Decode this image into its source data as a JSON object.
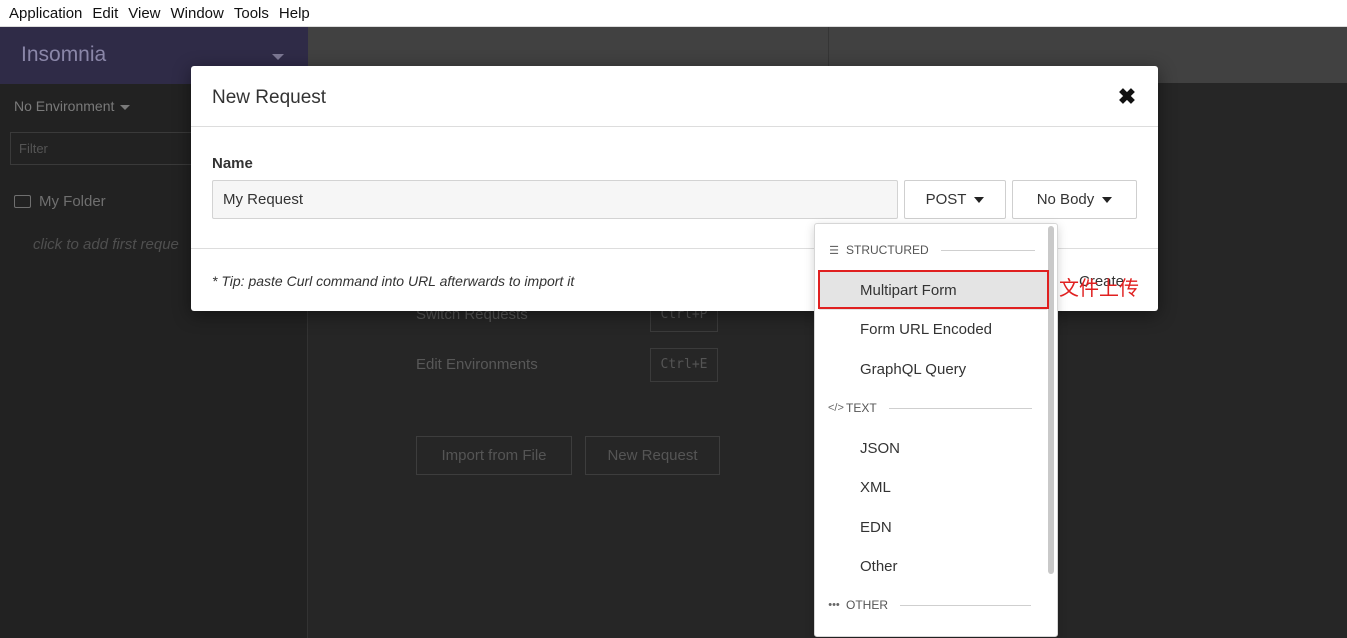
{
  "menubar": {
    "items": [
      "Application",
      "Edit",
      "View",
      "Window",
      "Tools",
      "Help"
    ]
  },
  "sidebar": {
    "title": "Insomnia",
    "environment": "No Environment",
    "filter_placeholder": "Filter",
    "folder": "My Folder",
    "empty_hint": "click to add first reque"
  },
  "main": {
    "shortcuts": [
      {
        "label": "Switch Requests",
        "key": "Ctrl+P"
      },
      {
        "label": "Edit Environments",
        "key": "Ctrl+E"
      }
    ],
    "import_button": "Import from File",
    "new_request_button": "New Request"
  },
  "modal": {
    "title": "New Request",
    "name_label": "Name",
    "name_value": "My Request",
    "method": "POST",
    "body": "No Body",
    "tip": "* Tip: paste Curl command into URL afterwards to import it",
    "create_button": "Create"
  },
  "dropdown": {
    "sections": [
      {
        "title": "STRUCTURED",
        "icon": "bars-icon",
        "items": [
          "Multipart Form",
          "Form URL Encoded",
          "GraphQL Query"
        ]
      },
      {
        "title": "TEXT",
        "icon": "code-icon",
        "items": [
          "JSON",
          "XML",
          "EDN",
          "Other"
        ]
      },
      {
        "title": "OTHER",
        "icon": "ellipsis-icon",
        "items": []
      }
    ],
    "active_item": "Multipart Form"
  },
  "annotation": {
    "text": "文件上传",
    "color": "#e02020"
  }
}
